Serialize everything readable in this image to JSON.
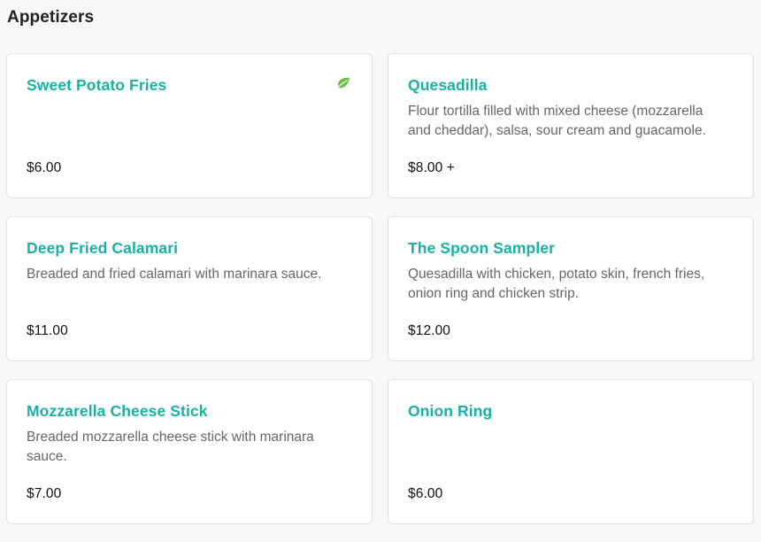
{
  "section": {
    "title": "Appetizers"
  },
  "colors": {
    "accent": "#19b0a5",
    "leaf": "#6cc04a"
  },
  "items": [
    {
      "name": "Sweet Potato Fries",
      "description": "",
      "price": "$6.00",
      "icon": "leaf-icon"
    },
    {
      "name": "Quesadilla",
      "description": "Flour tortilla filled with mixed cheese (mozzarella and cheddar), salsa, sour cream and guacamole.",
      "price": "$8.00 +"
    },
    {
      "name": "Deep Fried Calamari",
      "description": "Breaded and fried calamari with marinara sauce.",
      "price": "$11.00"
    },
    {
      "name": "The Spoon Sampler",
      "description": "Quesadilla with chicken, potato skin, french fries, onion ring and chicken strip.",
      "price": "$12.00"
    },
    {
      "name": "Mozzarella Cheese Stick",
      "description": "Breaded mozzarella cheese stick with marinara sauce.",
      "price": "$7.00"
    },
    {
      "name": "Onion Ring",
      "description": "",
      "price": "$6.00"
    }
  ]
}
